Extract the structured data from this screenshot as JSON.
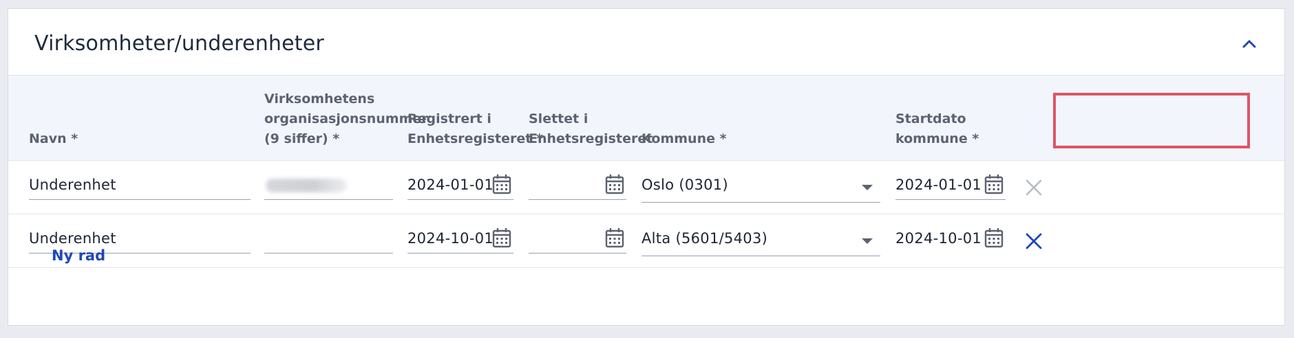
{
  "panel": {
    "title": "Virksomheter/underenheter"
  },
  "columns": [
    {
      "key": "navn",
      "label": "Navn *"
    },
    {
      "key": "orgnr",
      "label": "Virksomhetens\norganisasjonsnummer\n(9 siffer) *"
    },
    {
      "key": "registrert",
      "label": "Registrert i\nEnhetsregisteret *"
    },
    {
      "key": "slettet",
      "label": "Slettet i\nEnhetsregisteret"
    },
    {
      "key": "kommune",
      "label": "Kommune *"
    },
    {
      "key": "startdato",
      "label": "Startdato\nkommune *"
    }
  ],
  "rows": [
    {
      "navn": "Underenhet",
      "orgnr": "",
      "orgnr_redacted": true,
      "registrert": "2024-01-01",
      "slettet": "",
      "kommune": "Oslo (0301)",
      "startdato": "2024-01-01",
      "remove_enabled": false
    },
    {
      "navn": "Underenhet",
      "orgnr": "",
      "orgnr_redacted": false,
      "registrert": "2024-10-01",
      "slettet": "",
      "kommune": "Alta (5601/5403)",
      "startdato": "2024-10-01",
      "remove_enabled": true
    }
  ],
  "actions": {
    "new_row_label": "Ny rad"
  },
  "icons": {
    "collapse": "chevron-up-icon",
    "calendar": "calendar-icon",
    "dropdown": "caret-down-icon",
    "remove": "close-icon"
  },
  "colors": {
    "accent": "#1f47b8",
    "highlight": "#e05563",
    "header_bg": "#f2f5fc",
    "disabled": "#b8bcc4"
  }
}
